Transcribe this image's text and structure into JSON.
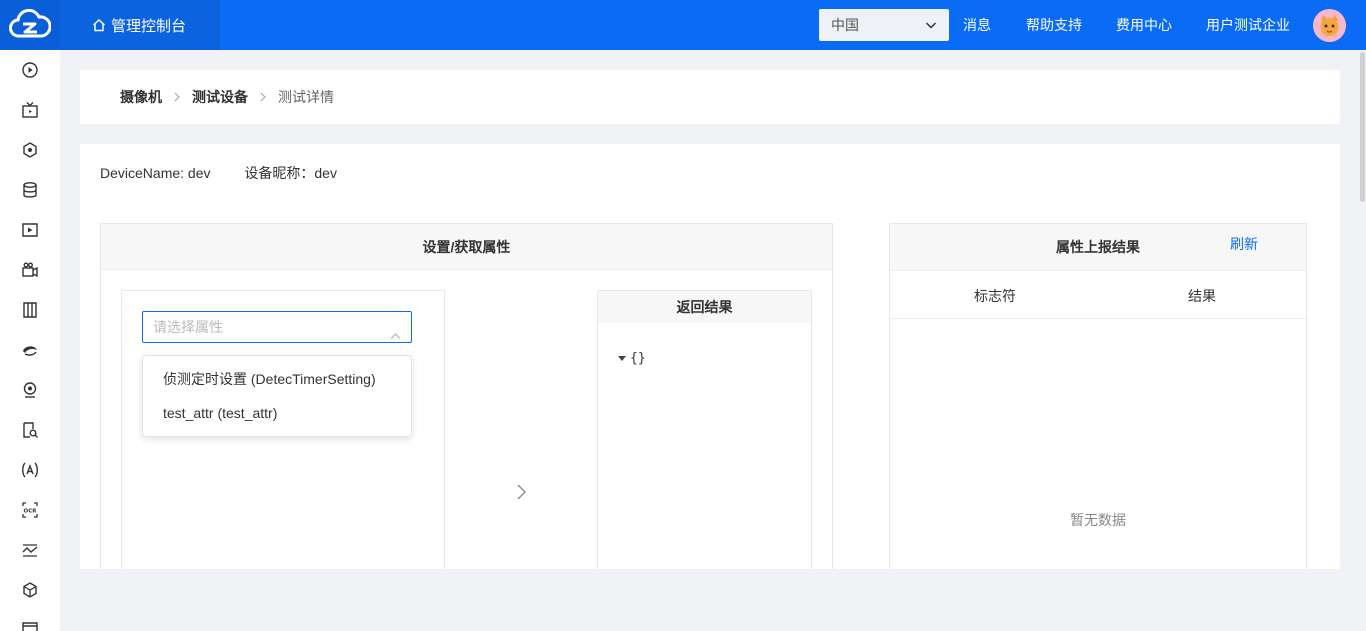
{
  "header": {
    "console_label": "管理控制台",
    "region_value": "中国",
    "links": [
      "消息",
      "帮助支持",
      "费用中心",
      "用户测试企业"
    ]
  },
  "breadcrumb": {
    "items": [
      "摄像机",
      "测试设备",
      "测试详情"
    ]
  },
  "device": {
    "name_label": "DeviceName: dev",
    "nickname_label": "设备昵称：dev"
  },
  "left_panel": {
    "title": "设置/获取属性",
    "select_placeholder": "请选择属性",
    "options": [
      "侦测定时设置 (DetecTimerSetting)",
      "test_attr (test_attr)"
    ],
    "result_title": "返回结果",
    "result_json": "{}"
  },
  "right_panel": {
    "title": "属性上报结果",
    "refresh_label": "刷新",
    "columns": [
      "标志符",
      "结果"
    ],
    "empty_text": "暂无数据"
  },
  "colors": {
    "primary": "#0a6cf5",
    "background": "#f0f2f5"
  }
}
